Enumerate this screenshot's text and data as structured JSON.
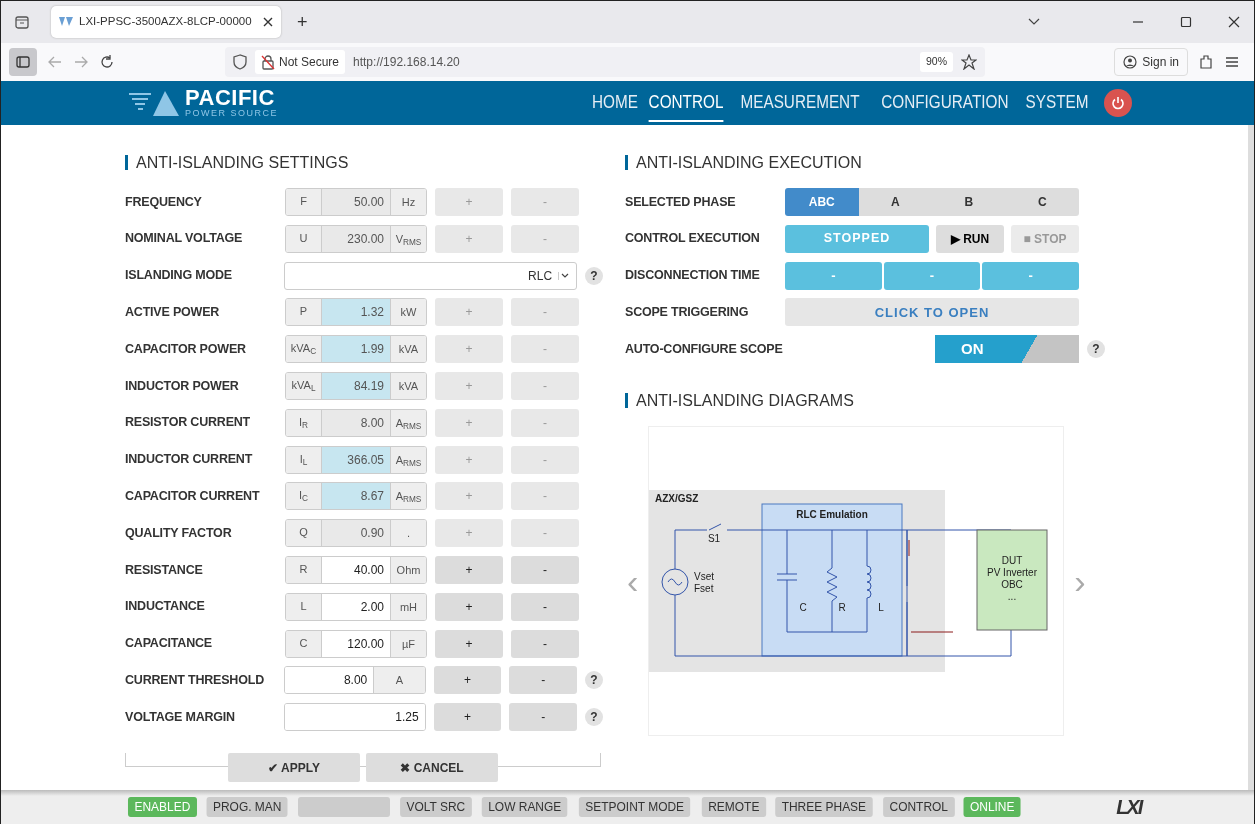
{
  "browser": {
    "tab_title": "LXI-PPSC-3500AZX-8LCP-00000",
    "new_tab": "+",
    "security": "Not Secure",
    "url": "http://192.168.14.20",
    "zoom": "90%",
    "sign_in": "Sign in"
  },
  "navbar": {
    "brand": "PACIFIC",
    "brand_sub": "POWER SOURCE",
    "items": [
      {
        "label": "HOME",
        "selected": false
      },
      {
        "label": "CONTROL",
        "selected": true
      },
      {
        "label": "MEASUREMENT",
        "selected": false
      },
      {
        "label": "CONFIGURATION",
        "selected": false
      },
      {
        "label": "SYSTEM",
        "selected": false
      }
    ]
  },
  "settings": {
    "title": "ANTI-ISLANDING SETTINGS",
    "rows": [
      {
        "kind": "group",
        "label": "FREQUENCY",
        "symbol": "F",
        "value": "50.00",
        "unit": "Hz",
        "highlighted": false,
        "plus": "+",
        "minus": "-",
        "disabled": true
      },
      {
        "kind": "group",
        "label": "NOMINAL VOLTAGE",
        "symbol": "U",
        "value": "230.00",
        "unit": "V$_{RMS}$",
        "highlighted": false,
        "plus": "+",
        "minus": "-",
        "disabled": true
      },
      {
        "kind": "select",
        "label": "ISLANDING MODE",
        "value": "RLC",
        "help": "?"
      },
      {
        "kind": "group",
        "label": "ACTIVE POWER",
        "symbol": "P",
        "value": "1.32",
        "unit": "kW",
        "highlighted": true,
        "plus": "+",
        "minus": "-",
        "disabled": true
      },
      {
        "kind": "group",
        "label": "CAPACITOR POWER",
        "symbol": "kVA$_{C}$",
        "value": "1.99",
        "unit": "kVA",
        "highlighted": true,
        "plus": "+",
        "minus": "-",
        "disabled": true
      },
      {
        "kind": "group",
        "label": "INDUCTOR POWER",
        "symbol": "kVA$_{L}$",
        "value": "84.19",
        "unit": "kVA",
        "highlighted": true,
        "plus": "+",
        "minus": "-",
        "disabled": true
      },
      {
        "kind": "group",
        "label": "RESISTOR CURRENT",
        "symbol": "I$_{R}$",
        "value": "8.00",
        "unit": "A$_{RMS}$",
        "highlighted": false,
        "plus": "+",
        "minus": "-",
        "disabled": true
      },
      {
        "kind": "group",
        "label": "INDUCTOR CURRENT",
        "symbol": "I$_{L}$",
        "value": "366.05",
        "unit": "A$_{RMS}$",
        "highlighted": true,
        "plus": "+",
        "minus": "-",
        "disabled": true
      },
      {
        "kind": "group",
        "label": "CAPACITOR CURRENT",
        "symbol": "I$_{C}$",
        "value": "8.67",
        "unit": "A$_{RMS}$",
        "highlighted": true,
        "plus": "+",
        "minus": "-",
        "disabled": true
      },
      {
        "kind": "group",
        "label": "QUALITY FACTOR",
        "symbol": "Q",
        "value": "0.90",
        "unit": ".",
        "highlighted": false,
        "plus": "+",
        "minus": "-",
        "disabled": true
      },
      {
        "kind": "group",
        "label": "RESISTANCE",
        "symbol": "R",
        "value": "40.00",
        "unit": "Ohm",
        "highlighted": false,
        "plus": "+",
        "minus": "-",
        "disabled": false
      },
      {
        "kind": "group",
        "label": "INDUCTANCE",
        "symbol": "L",
        "value": "2.00",
        "unit": "mH",
        "highlighted": false,
        "plus": "+",
        "minus": "-",
        "disabled": false
      },
      {
        "kind": "group",
        "label": "CAPACITANCE",
        "symbol": "C",
        "value": "120.00",
        "unit": "µF",
        "highlighted": false,
        "plus": "+",
        "minus": "-",
        "disabled": false
      },
      {
        "kind": "suffix",
        "label": "CURRENT THRESHOLD",
        "value": "8.00",
        "unit": "A",
        "highlighted": false,
        "plus": "+",
        "minus": "-",
        "disabled": false,
        "help": "?"
      },
      {
        "kind": "plain",
        "label": "VOLTAGE MARGIN",
        "value": "1.25",
        "highlighted": false,
        "plus": "+",
        "minus": "-",
        "disabled": false,
        "help": "?"
      }
    ],
    "apply": "APPLY",
    "cancel": "CANCEL",
    "apply_icon": "✔",
    "cancel_icon": "✖"
  },
  "execution": {
    "title": "ANTI-ISLANDING EXECUTION",
    "rows": [
      {
        "kind": "segments",
        "label": "SELECTED PHASE",
        "options": [
          {
            "label": "ABC",
            "selected": true
          },
          {
            "label": "A",
            "selected": false
          },
          {
            "label": "B",
            "selected": false
          },
          {
            "label": "C",
            "selected": false
          }
        ]
      },
      {
        "kind": "run",
        "label": "CONTROL EXECUTION",
        "status": "STOPPED",
        "run_icon": "▶",
        "run": "RUN",
        "stop_icon": "■",
        "stop": "STOP",
        "run_disabled": false,
        "stop_disabled": true
      },
      {
        "kind": "times",
        "label": "DISCONNECTION TIME",
        "values": [
          "-",
          "-",
          "-"
        ]
      },
      {
        "kind": "open",
        "label": "SCOPE TRIGGERING",
        "button": "CLICK TO OPEN"
      },
      {
        "kind": "toggle",
        "label": "AUTO-CONFIGURE SCOPE",
        "toggle": "ON",
        "on": true,
        "help": "?"
      }
    ]
  },
  "diagrams": {
    "title": "ANTI-ISLANDING DIAGRAMS",
    "prev": "‹",
    "next": "›",
    "labels": {
      "system": "AZX/GSZ",
      "block": "RLC Emulation",
      "switch": "S1",
      "source": [
        "Vset",
        "Fset"
      ],
      "c": "C",
      "r": "R",
      "l": "L",
      "dut": [
        "DUT",
        "PV Inverter",
        "OBC",
        "..."
      ]
    }
  },
  "status_bar": {
    "items": [
      {
        "label": "ENABLED",
        "color": "#5cb85c"
      },
      {
        "label": "PROG. MAN",
        "color": "#cccccc"
      },
      {
        "color": "#cccccc"
      },
      {
        "label": "VOLT SRC",
        "color": "#cccccc"
      },
      {
        "label": "LOW RANGE",
        "color": "#cccccc"
      },
      {
        "label": "SETPOINT MODE",
        "color": "#cccccc"
      },
      {
        "label": "REMOTE",
        "color": "#cccccc"
      },
      {
        "label": "THREE PHASE",
        "color": "#cccccc"
      },
      {
        "label": "CONTROL",
        "color": "#cccccc"
      },
      {
        "label": "ONLINE",
        "color": "#5cb85c"
      }
    ],
    "logo": "LXI"
  }
}
